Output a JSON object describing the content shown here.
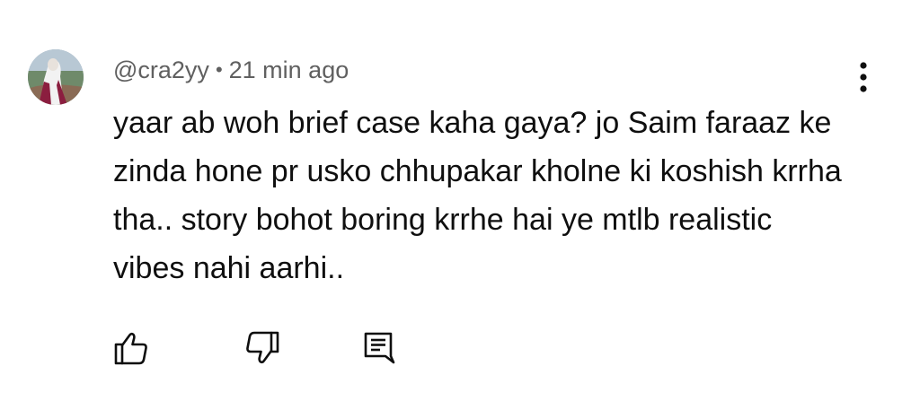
{
  "comment": {
    "author": "@cra2yy",
    "separator": "•",
    "timestamp": "21 min ago",
    "text": "yaar ab woh brief case kaha gaya? jo Saim faraaz ke zinda hone pr usko chhupakar kholne ki koshish krrha tha.. story bohot boring krrhe hai ye mtlb realistic vibes nahi aarhi..",
    "avatar_icon": "user-avatar-photo"
  },
  "actions": {
    "like_icon": "thumbs-up-icon",
    "dislike_icon": "thumbs-down-icon",
    "reply_icon": "reply-comment-icon",
    "more_icon": "more-vertical-icon"
  },
  "colors": {
    "text_primary": "#0f0f0f",
    "text_secondary": "#606060",
    "background": "#ffffff"
  }
}
